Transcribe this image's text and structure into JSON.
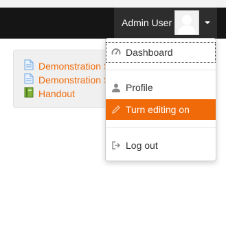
{
  "header": {
    "user_name": "Admin User",
    "avatar_icon": "user-avatar-icon",
    "caret_icon": "caret-down-icon"
  },
  "block": {
    "items": [
      {
        "label": "Demonstration S",
        "icon": "file-icon"
      },
      {
        "label": "Demonstration S",
        "icon": "file-icon"
      },
      {
        "label": "Handout",
        "icon": "book-icon"
      }
    ]
  },
  "user_menu": {
    "items": [
      {
        "label": "Dashboard",
        "icon": "dashboard-icon"
      },
      {
        "label": "Profile",
        "icon": "user-icon"
      },
      {
        "label": "Turn editing on",
        "icon": "pencil-icon"
      },
      {
        "label": "Log out",
        "icon": "logout-icon"
      }
    ]
  },
  "colors": {
    "accent": "#f06a0a",
    "navbar": "#151515"
  }
}
